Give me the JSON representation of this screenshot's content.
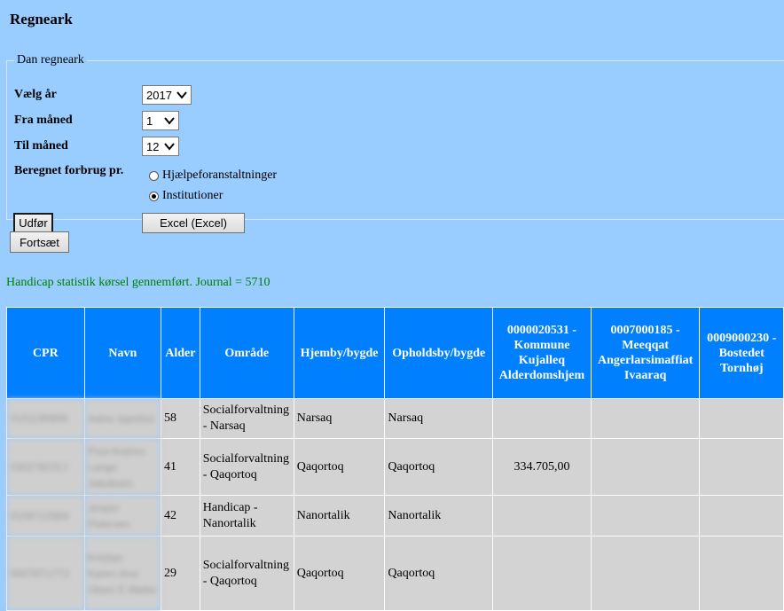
{
  "page": {
    "title": "Regneark"
  },
  "form": {
    "legend": "Dan regneark",
    "year_label": "Vælg år",
    "year_value": "2017",
    "from_month_label": "Fra måned",
    "from_month_value": "1",
    "to_month_label": "Til måned",
    "to_month_value": "12",
    "calc_label": "Beregnet forbrug pr.",
    "radio_options": [
      {
        "label": "Hjælpeforanstaltninger",
        "selected": false
      },
      {
        "label": "Institutioner",
        "selected": true
      }
    ],
    "execute_label": "Udfør",
    "excel_label": "Excel (Excel)"
  },
  "continue_label": "Fortsæt",
  "status_message": "Handicap statistik kørsel gennemført. Journal = 5710",
  "table": {
    "headers": [
      "CPR",
      "Navn",
      "Alder",
      "Område",
      "Hjemby/bygde",
      "Opholdsby/bygde",
      "0000020531 - Kommune Kujalleq Alderdomshjem",
      "0007000185 - Meeqqat Angerlarsimaffiat Ivaaraq",
      "0009000230 - Bostedet Tornhøj"
    ],
    "rows": [
      {
        "cpr": "0101190806",
        "name": "Aaloo Ippolisa",
        "age": "58",
        "area": "Socialforvaltning - Narsaq",
        "home": "Narsaq",
        "stay": "Narsaq",
        "c1": "",
        "c2": "",
        "c3": ""
      },
      {
        "cpr": "0302782317",
        "name": "Poul Andreo Lange Jakobsen",
        "age": "41",
        "area": "Socialforvaltning - Qaqortoq",
        "home": "Qaqortoq",
        "stay": "Qaqortoq",
        "c1": "334.705,00",
        "c2": "",
        "c3": ""
      },
      {
        "cpr": "0104712684",
        "name": "Jesper Petersen",
        "age": "42",
        "area": "Handicap - Nanortalik",
        "home": "Nanortalik",
        "stay": "Nanortalik",
        "c1": "",
        "c2": "",
        "c3": ""
      },
      {
        "cpr": "0007871773",
        "name": "Kristian Karen-Ane Olsen E Malke",
        "age": "29",
        "area": "Socialforvaltning - Qaqortoq",
        "home": "Qaqortoq",
        "stay": "Qaqortoq",
        "c1": "",
        "c2": "",
        "c3": ""
      }
    ]
  },
  "colors": {
    "page_bg": "#99ccff",
    "header_bg": "#0080ff",
    "cell_bg": "#d3d3d3",
    "status": "#008000"
  }
}
